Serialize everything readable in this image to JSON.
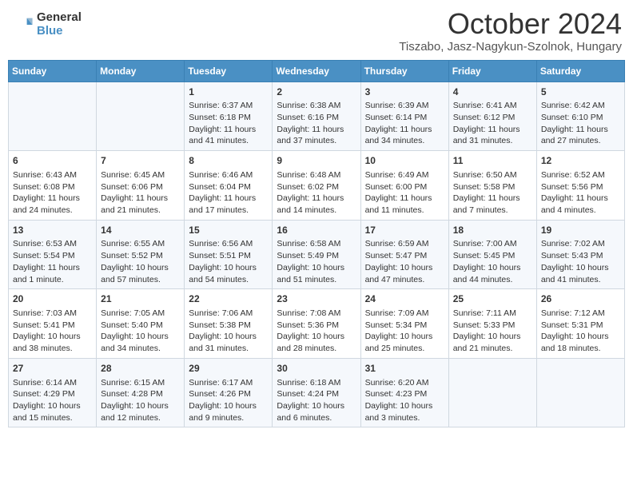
{
  "logo": {
    "general": "General",
    "blue": "Blue"
  },
  "header": {
    "title": "October 2024",
    "subtitle": "Tiszabo, Jasz-Nagykun-Szolnok, Hungary"
  },
  "days": [
    "Sunday",
    "Monday",
    "Tuesday",
    "Wednesday",
    "Thursday",
    "Friday",
    "Saturday"
  ],
  "weeks": [
    [
      {
        "day": "",
        "content": ""
      },
      {
        "day": "",
        "content": ""
      },
      {
        "day": "1",
        "content": "Sunrise: 6:37 AM\nSunset: 6:18 PM\nDaylight: 11 hours and 41 minutes."
      },
      {
        "day": "2",
        "content": "Sunrise: 6:38 AM\nSunset: 6:16 PM\nDaylight: 11 hours and 37 minutes."
      },
      {
        "day": "3",
        "content": "Sunrise: 6:39 AM\nSunset: 6:14 PM\nDaylight: 11 hours and 34 minutes."
      },
      {
        "day": "4",
        "content": "Sunrise: 6:41 AM\nSunset: 6:12 PM\nDaylight: 11 hours and 31 minutes."
      },
      {
        "day": "5",
        "content": "Sunrise: 6:42 AM\nSunset: 6:10 PM\nDaylight: 11 hours and 27 minutes."
      }
    ],
    [
      {
        "day": "6",
        "content": "Sunrise: 6:43 AM\nSunset: 6:08 PM\nDaylight: 11 hours and 24 minutes."
      },
      {
        "day": "7",
        "content": "Sunrise: 6:45 AM\nSunset: 6:06 PM\nDaylight: 11 hours and 21 minutes."
      },
      {
        "day": "8",
        "content": "Sunrise: 6:46 AM\nSunset: 6:04 PM\nDaylight: 11 hours and 17 minutes."
      },
      {
        "day": "9",
        "content": "Sunrise: 6:48 AM\nSunset: 6:02 PM\nDaylight: 11 hours and 14 minutes."
      },
      {
        "day": "10",
        "content": "Sunrise: 6:49 AM\nSunset: 6:00 PM\nDaylight: 11 hours and 11 minutes."
      },
      {
        "day": "11",
        "content": "Sunrise: 6:50 AM\nSunset: 5:58 PM\nDaylight: 11 hours and 7 minutes."
      },
      {
        "day": "12",
        "content": "Sunrise: 6:52 AM\nSunset: 5:56 PM\nDaylight: 11 hours and 4 minutes."
      }
    ],
    [
      {
        "day": "13",
        "content": "Sunrise: 6:53 AM\nSunset: 5:54 PM\nDaylight: 11 hours and 1 minute."
      },
      {
        "day": "14",
        "content": "Sunrise: 6:55 AM\nSunset: 5:52 PM\nDaylight: 10 hours and 57 minutes."
      },
      {
        "day": "15",
        "content": "Sunrise: 6:56 AM\nSunset: 5:51 PM\nDaylight: 10 hours and 54 minutes."
      },
      {
        "day": "16",
        "content": "Sunrise: 6:58 AM\nSunset: 5:49 PM\nDaylight: 10 hours and 51 minutes."
      },
      {
        "day": "17",
        "content": "Sunrise: 6:59 AM\nSunset: 5:47 PM\nDaylight: 10 hours and 47 minutes."
      },
      {
        "day": "18",
        "content": "Sunrise: 7:00 AM\nSunset: 5:45 PM\nDaylight: 10 hours and 44 minutes."
      },
      {
        "day": "19",
        "content": "Sunrise: 7:02 AM\nSunset: 5:43 PM\nDaylight: 10 hours and 41 minutes."
      }
    ],
    [
      {
        "day": "20",
        "content": "Sunrise: 7:03 AM\nSunset: 5:41 PM\nDaylight: 10 hours and 38 minutes."
      },
      {
        "day": "21",
        "content": "Sunrise: 7:05 AM\nSunset: 5:40 PM\nDaylight: 10 hours and 34 minutes."
      },
      {
        "day": "22",
        "content": "Sunrise: 7:06 AM\nSunset: 5:38 PM\nDaylight: 10 hours and 31 minutes."
      },
      {
        "day": "23",
        "content": "Sunrise: 7:08 AM\nSunset: 5:36 PM\nDaylight: 10 hours and 28 minutes."
      },
      {
        "day": "24",
        "content": "Sunrise: 7:09 AM\nSunset: 5:34 PM\nDaylight: 10 hours and 25 minutes."
      },
      {
        "day": "25",
        "content": "Sunrise: 7:11 AM\nSunset: 5:33 PM\nDaylight: 10 hours and 21 minutes."
      },
      {
        "day": "26",
        "content": "Sunrise: 7:12 AM\nSunset: 5:31 PM\nDaylight: 10 hours and 18 minutes."
      }
    ],
    [
      {
        "day": "27",
        "content": "Sunrise: 6:14 AM\nSunset: 4:29 PM\nDaylight: 10 hours and 15 minutes."
      },
      {
        "day": "28",
        "content": "Sunrise: 6:15 AM\nSunset: 4:28 PM\nDaylight: 10 hours and 12 minutes."
      },
      {
        "day": "29",
        "content": "Sunrise: 6:17 AM\nSunset: 4:26 PM\nDaylight: 10 hours and 9 minutes."
      },
      {
        "day": "30",
        "content": "Sunrise: 6:18 AM\nSunset: 4:24 PM\nDaylight: 10 hours and 6 minutes."
      },
      {
        "day": "31",
        "content": "Sunrise: 6:20 AM\nSunset: 4:23 PM\nDaylight: 10 hours and 3 minutes."
      },
      {
        "day": "",
        "content": ""
      },
      {
        "day": "",
        "content": ""
      }
    ]
  ]
}
